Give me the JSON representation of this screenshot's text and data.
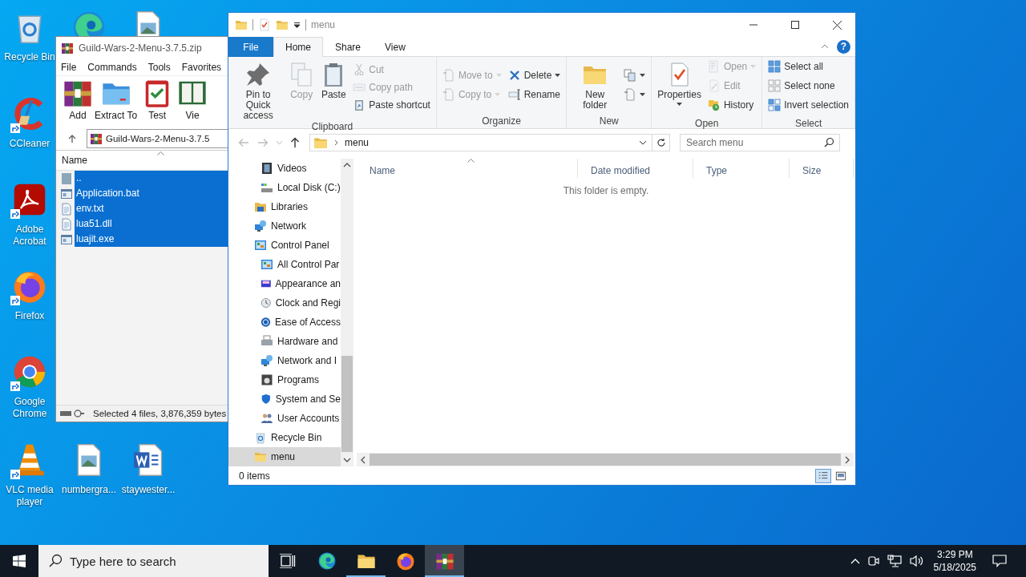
{
  "desktop": {
    "icons": [
      {
        "kind": "recycle-bin",
        "label": "Recycle Bin",
        "shortcut": false
      },
      {
        "kind": "edge",
        "shortcut": false
      },
      {
        "kind": "image-file",
        "shortcut": false
      },
      {
        "kind": "ccleaner",
        "label": "CCleaner",
        "shortcut": true
      },
      {
        "kind": "acrobat",
        "label": "Adobe Acrobat",
        "shortcut": true
      },
      {
        "kind": "firefox",
        "label": "Firefox",
        "shortcut": true
      },
      {
        "kind": "chrome",
        "label": "Google Chrome",
        "shortcut": true
      },
      {
        "kind": "vlc",
        "label": "VLC media player",
        "shortcut": true
      },
      {
        "kind": "image-file",
        "label": "numbergra...",
        "shortcut": false
      },
      {
        "kind": "word-file",
        "label": "staywester...",
        "shortcut": false
      }
    ]
  },
  "winrar": {
    "title": "Guild-Wars-2-Menu-3.7.5.zip",
    "menu": [
      "File",
      "Commands",
      "Tools",
      "Favorites"
    ],
    "toolbar": [
      {
        "kind": "books",
        "label": "Add"
      },
      {
        "kind": "extract",
        "label": "Extract To"
      },
      {
        "kind": "test",
        "label": "Test"
      },
      {
        "kind": "book",
        "label": "Vie"
      }
    ],
    "path": "Guild-Wars-2-Menu-3.7.5",
    "columns": [
      {
        "label": "Name",
        "sorted": true
      }
    ],
    "files": [
      {
        "name": "..",
        "kind": "parent",
        "selected": true
      },
      {
        "name": "Application.bat",
        "kind": "bat",
        "selected": true
      },
      {
        "name": "env.txt",
        "kind": "txt",
        "selected": true
      },
      {
        "name": "lua51.dll",
        "kind": "dll",
        "selected": true
      },
      {
        "name": "luajit.exe",
        "kind": "exe",
        "selected": true
      }
    ],
    "status": "Selected 4 files, 3,876,359 bytes"
  },
  "explorer": {
    "title": "menu",
    "tabs": [
      {
        "label": "File",
        "kind": "file",
        "selected": false
      },
      {
        "label": "Home",
        "kind": "tab",
        "selected": true
      },
      {
        "label": "Share",
        "kind": "tab",
        "selected": false
      },
      {
        "label": "View",
        "kind": "tab",
        "selected": false
      }
    ],
    "help": "?",
    "ribbon": [
      {
        "label": "Clipboard",
        "columns": [
          [
            {
              "kind": "large",
              "label": "Pin to Quick access",
              "dropdown": false,
              "disabled": false
            }
          ],
          [
            {
              "kind": "large",
              "label": "Copy",
              "dropdown": false,
              "disabled": true
            }
          ],
          [
            {
              "kind": "large",
              "label": "Paste",
              "dropdown": false,
              "disabled": false
            }
          ],
          [
            {
              "kind": "small",
              "label": "Cut",
              "dropdown": false,
              "disabled": true
            },
            {
              "kind": "small",
              "label": "Copy path",
              "dropdown": false,
              "disabled": true
            },
            {
              "kind": "small",
              "label": "Paste shortcut",
              "dropdown": false,
              "disabled": false
            }
          ]
        ]
      },
      {
        "label": "Organize",
        "columns": [
          [
            {
              "kind": "small",
              "label": "Move to",
              "dropdown": true,
              "disabled": true
            },
            {
              "kind": "small",
              "label": "Copy to",
              "dropdown": true,
              "disabled": true
            }
          ],
          [
            {
              "kind": "small",
              "label": "Delete",
              "dropdown": true,
              "disabled": false
            },
            {
              "kind": "small",
              "label": "Rename",
              "dropdown": false,
              "disabled": false
            }
          ]
        ]
      },
      {
        "label": "New",
        "columns": [
          [
            {
              "kind": "large",
              "label": "New folder",
              "dropdown": false,
              "disabled": false
            }
          ],
          [
            {
              "kind": "small",
              "dropdown": true,
              "disabled": false
            },
            {
              "kind": "small",
              "dropdown": true,
              "disabled": false
            }
          ]
        ]
      },
      {
        "label": "Open",
        "columns": [
          [
            {
              "kind": "large",
              "label": "Properties",
              "dropdown": true,
              "disabled": false
            }
          ],
          [
            {
              "kind": "small",
              "label": "Open",
              "dropdown": true,
              "disabled": true
            },
            {
              "kind": "small",
              "label": "Edit",
              "dropdown": false,
              "disabled": true
            },
            {
              "kind": "small",
              "label": "History",
              "dropdown": false,
              "disabled": false
            }
          ]
        ]
      },
      {
        "label": "Select",
        "columns": [
          [
            {
              "kind": "small",
              "label": "Select all",
              "dropdown": false,
              "disabled": false
            },
            {
              "kind": "small",
              "label": "Select none",
              "dropdown": false,
              "disabled": false
            },
            {
              "kind": "small",
              "label": "Invert selection",
              "dropdown": false,
              "disabled": false
            }
          ]
        ]
      }
    ],
    "address": "menu",
    "search": {
      "placeholder": "Search menu"
    },
    "nav": [
      {
        "children": [
          {
            "label": "Videos",
            "kind": "videos",
            "selected": false
          },
          {
            "label": "Local Disk (C:)",
            "kind": "disk",
            "selected": false
          }
        ]
      },
      {
        "label": "Libraries",
        "kind": "libraries",
        "selected": false
      },
      {
        "label": "Network",
        "kind": "network",
        "selected": false
      },
      {
        "label": "Control Panel",
        "kind": "control-panel",
        "selected": false,
        "children": [
          {
            "label": "All Control Par",
            "kind": "control-panel",
            "selected": false
          },
          {
            "label": "Appearance an",
            "kind": "appearance",
            "selected": false
          },
          {
            "label": "Clock and Regi",
            "kind": "clock",
            "selected": false
          },
          {
            "label": "Ease of Access",
            "kind": "ease",
            "selected": false
          },
          {
            "label": "Hardware and",
            "kind": "printer",
            "selected": false
          },
          {
            "label": "Network and I",
            "kind": "network",
            "selected": false
          },
          {
            "label": "Programs",
            "kind": "programs",
            "selected": false
          },
          {
            "label": "System and Se",
            "kind": "shield",
            "selected": false
          },
          {
            "label": "User Accounts",
            "kind": "users",
            "selected": false
          }
        ]
      },
      {
        "label": "Recycle Bin",
        "kind": "recycle-bin",
        "selected": false
      },
      {
        "label": "menu",
        "kind": "folder",
        "selected": true
      }
    ],
    "columns": [
      {
        "label": "Name",
        "sorted": true
      },
      {
        "label": "Date modified",
        "sorted": false
      },
      {
        "label": "Type",
        "sorted": false
      },
      {
        "label": "Size",
        "sorted": false
      }
    ],
    "empty_text": "This folder is empty.",
    "status": "0 items",
    "views": [
      {
        "kind": "details",
        "selected": true
      },
      {
        "kind": "large-icons",
        "selected": false
      }
    ]
  },
  "taskbar": {
    "search": {
      "placeholder": "Type here to search"
    },
    "apps": [
      {
        "kind": "edge",
        "running": false,
        "selected": false
      },
      {
        "kind": "explorer",
        "running": true,
        "selected": false
      },
      {
        "kind": "firefox",
        "running": false,
        "selected": false
      },
      {
        "kind": "winrar",
        "running": true,
        "selected": true
      }
    ],
    "time": "3:29 PM",
    "date": "5/18/2025"
  }
}
